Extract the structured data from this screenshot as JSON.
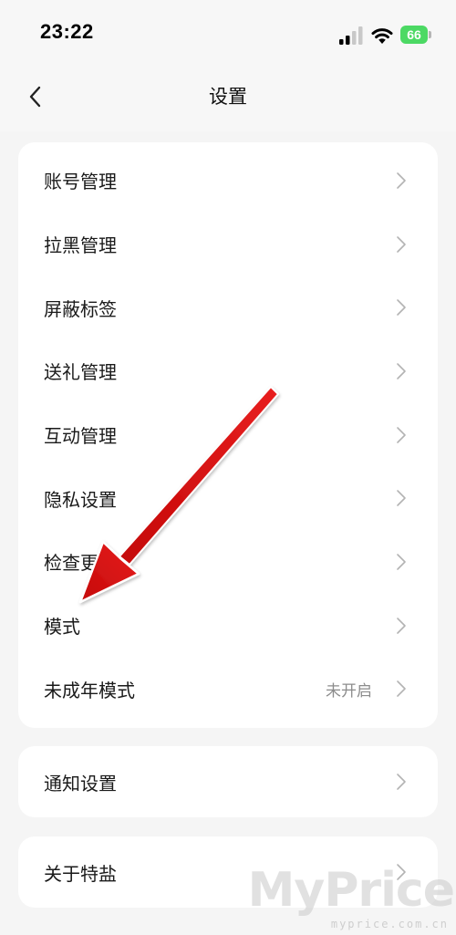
{
  "status_bar": {
    "time": "23:22",
    "battery": "66",
    "icons": [
      "cellular-signal-icon",
      "wifi-icon",
      "battery-icon"
    ]
  },
  "nav": {
    "title": "设置",
    "back_icon": "chevron-left-icon"
  },
  "settings_main": [
    {
      "label": "账号管理",
      "value": ""
    },
    {
      "label": "拉黑管理",
      "value": ""
    },
    {
      "label": "屏蔽标签",
      "value": ""
    },
    {
      "label": "送礼管理",
      "value": ""
    },
    {
      "label": "互动管理",
      "value": ""
    },
    {
      "label": "隐私设置",
      "value": ""
    },
    {
      "label": "检查更新",
      "value": ""
    },
    {
      "label": "模式",
      "value": ""
    },
    {
      "label": "未成年模式",
      "value": "未开启"
    }
  ],
  "settings_notify": {
    "label": "通知设置"
  },
  "settings_about": {
    "label": "关于特盐"
  },
  "annotation": {
    "arrow_color": "#e01010",
    "target": "模式"
  },
  "watermark": {
    "main": "MyPrice",
    "sub": "myprice.com.cn"
  },
  "colors": {
    "background": "#f5f5f5",
    "card": "#ffffff",
    "secondary_text": "#8c8c8c",
    "battery": "#4cd964"
  }
}
